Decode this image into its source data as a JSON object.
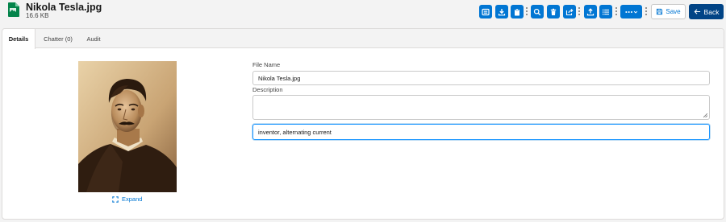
{
  "header": {
    "file_title": "Nikola Tesla.jpg",
    "file_size": "16.6 KB",
    "file_type": "JPG",
    "accent": "#0176d3",
    "icon": "file-jpg-icon"
  },
  "toolbar": {
    "icons": [
      "preview-icon",
      "download-icon",
      "clipboard-icon",
      "search-icon",
      "delete-icon",
      "share-icon",
      "upload-icon",
      "list-icon",
      "more-icon"
    ],
    "save_label": "Save",
    "back_label": "Back",
    "brand_dark": "#014486"
  },
  "tabs": [
    {
      "label": "Details",
      "active": true
    },
    {
      "label": "Chatter (0)",
      "active": false
    },
    {
      "label": "Audit",
      "active": false
    }
  ],
  "preview": {
    "expand_label": "Expand"
  },
  "form": {
    "file_name_label": "File Name",
    "file_name_value": "Nikola Tesla.jpg",
    "description_label": "Description",
    "description_value": "",
    "tags_value": "inventor, alternating current"
  }
}
